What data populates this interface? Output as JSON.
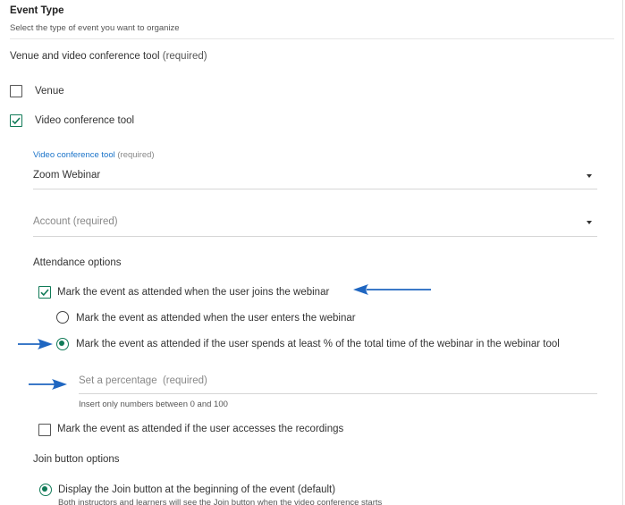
{
  "event_type": {
    "title": "Event Type",
    "subtitle": "Select the type of event you want to organize"
  },
  "venue_tool": {
    "label": "Venue and video conference tool",
    "required": "(required)",
    "venue_label": "Venue",
    "video_label": "Video conference tool"
  },
  "video_tool_select": {
    "label": "Video conference tool",
    "required": "(required)",
    "value": "Zoom Webinar"
  },
  "account_select": {
    "placeholder": "Account (required)"
  },
  "attendance": {
    "title": "Attendance options",
    "joins_label": "Mark the event as attended when the user joins the webinar",
    "enters_label": "Mark the event as attended when the user enters the webinar",
    "spends_label": "Mark the event as attended if the user spends at least % of the total time of the webinar in the webinar tool",
    "percentage_placeholder": "Set a percentage  (required)",
    "percentage_hint": "Insert only numbers between 0 and 100",
    "recordings_label": "Mark the event as attended if the user accesses the recordings"
  },
  "join_button": {
    "title": "Join button options",
    "beginning_label": "Display the Join button at the beginning of the event (default)",
    "beginning_hint": "Both instructors and learners will see the Join button when the video conference starts"
  },
  "colors": {
    "accent_green": "#107a57",
    "link_blue": "#1a73c9",
    "annotation_arrow": "#1f66c1"
  }
}
